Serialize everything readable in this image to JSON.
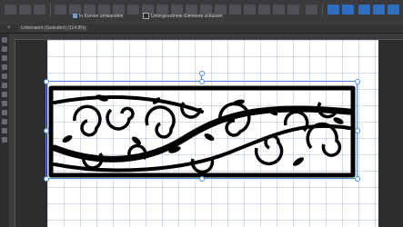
{
  "toolbar": {
    "snap_label": "In Kurven umwandeln",
    "protect_label": "Untergeordnete Elemente schützen"
  },
  "document": {
    "tab_label": "Unbenannt (Geändert) (114.8%)",
    "close_glyph": "×"
  },
  "colors": {
    "accent": "#2e6fc2",
    "selection": "#4a8be0",
    "canvas_bg": "#2c2c2e",
    "toolbar_bg": "#3a3a3d"
  }
}
